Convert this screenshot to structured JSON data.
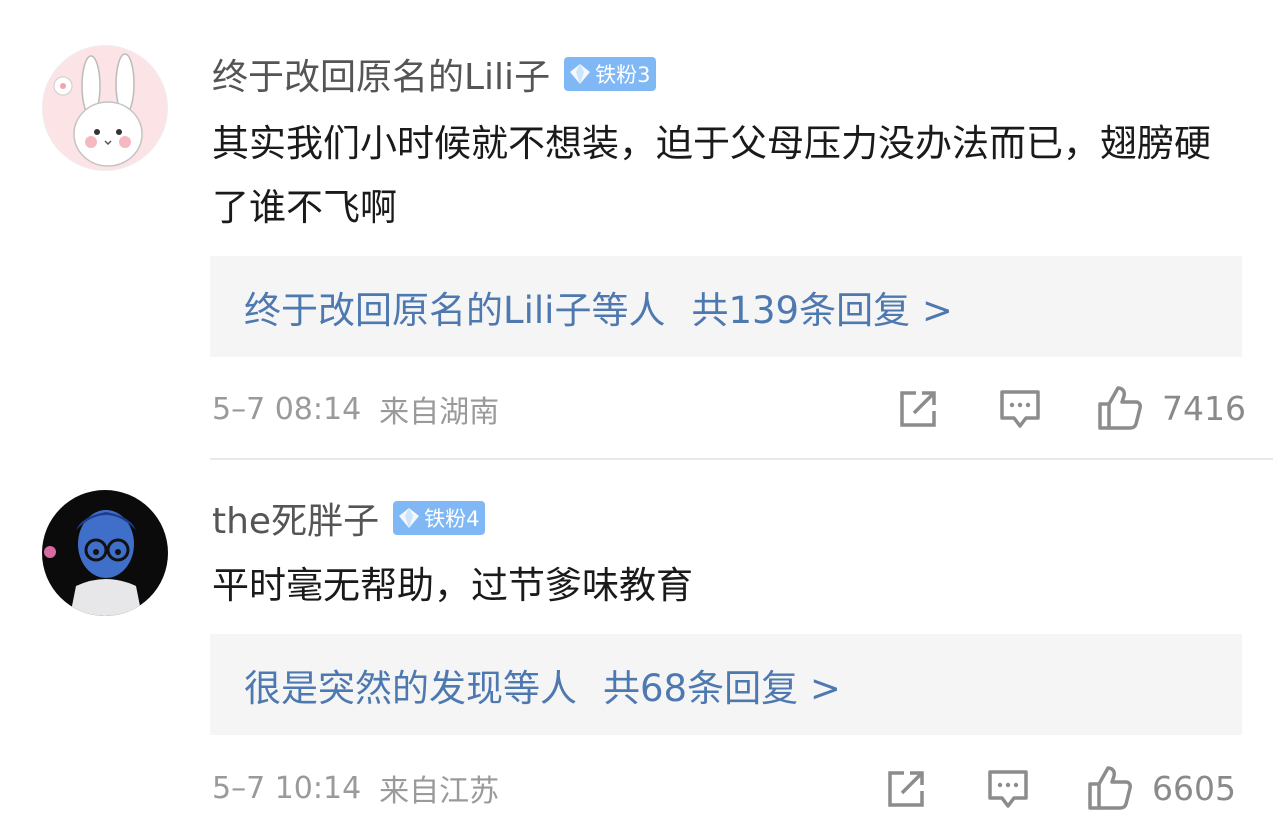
{
  "comments": [
    {
      "avatar": "bunny-avatar",
      "username": "终于改回原名的Lili子",
      "badge": "铁粉3",
      "text": "其实我们小时候就不想装，迫于父母压力没办法而已，翅膀硬了谁不飞啊",
      "replies": {
        "names": "终于改回原名的Lili子",
        "suffix": "等人",
        "count": "共139条回复 >"
      },
      "time": "5–7 08:14",
      "source": "来自湖南",
      "likes": "7416"
    },
    {
      "avatar": "sadness-avatar",
      "username": "the死胖子",
      "badge": "铁粉4",
      "text": "平时毫无帮助，过节爹味教育",
      "replies": {
        "names": "很是突然的发现",
        "suffix": "等人",
        "count": "共68条回复 >"
      },
      "time": "5–7 10:14",
      "source": "来自江苏",
      "likes": "6605"
    }
  ],
  "icons": {
    "share": "share-icon",
    "comment": "comment-icon",
    "like": "thumbs-up-icon",
    "badge": "diamond-icon"
  },
  "colors": {
    "link": "#4e79b0",
    "badge": "#7fb8f5",
    "meta": "#9a9a9a",
    "reply_bg": "#f5f5f5"
  }
}
